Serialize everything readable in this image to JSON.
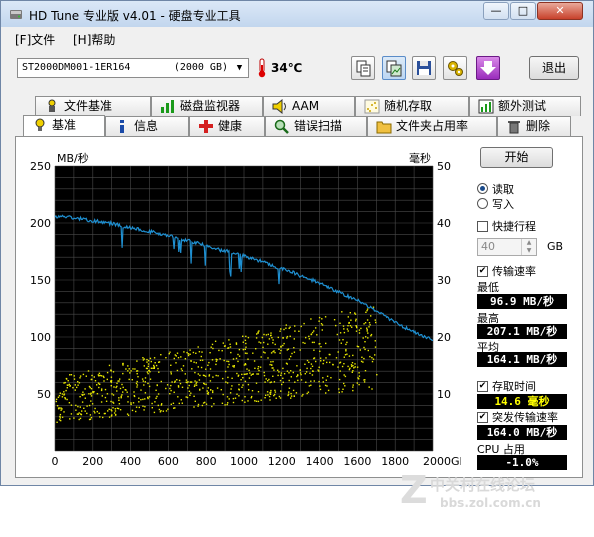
{
  "window": {
    "title": "HD Tune 专业版 v4.01 - 硬盘专业工具",
    "btn_min": "—",
    "btn_max": "□",
    "btn_close": "✕"
  },
  "menu": {
    "file": "[F]文件",
    "help": "[H]帮助"
  },
  "toolbar": {
    "drive_name": "ST2000DM001-1ER164",
    "drive_capacity": "(2000 GB)",
    "temperature": "34℃",
    "exit_label": "退出"
  },
  "tabs_top": [
    "文件基准",
    "磁盘监视器",
    "AAM",
    "随机存取",
    "额外测试"
  ],
  "tabs_bottom": [
    "基准",
    "信息",
    "健康",
    "错误扫描",
    "文件夹占用率",
    "删除"
  ],
  "right_panel": {
    "start_label": "开始",
    "read_label": "读取",
    "write_label": "写入",
    "short_stroke_label": "快捷行程",
    "short_stroke_value": "40",
    "short_stroke_unit": "GB",
    "transfer_rate_label": "传输速率",
    "min_label": "最低",
    "min_value": "96.9 MB/秒",
    "max_label": "最高",
    "max_value": "207.1 MB/秒",
    "avg_label": "平均",
    "avg_value": "164.1 MB/秒",
    "access_time_label": "存取时间",
    "access_time_value": "14.6 毫秒",
    "burst_label": "突发传输速率",
    "burst_value": "164.0 MB/秒",
    "cpu_label": "CPU 占用",
    "cpu_value": "-1.0%"
  },
  "watermark": {
    "line1": "中关村在线论坛",
    "line2": "bbs.zol.com.cn"
  },
  "colors": {
    "chart_bg": "#000000",
    "transfer_line": "#1f8fd0",
    "access_dots": "#e8e800",
    "grid": "#4a4a4a"
  },
  "chart_data": {
    "type": "line",
    "ylabel": "MB/秒",
    "y2label": "毫秒",
    "ylim": [
      0,
      250
    ],
    "y2lim": [
      0,
      50
    ],
    "xlim": [
      0,
      2000
    ],
    "x_ticks": [
      "0",
      "200",
      "400",
      "600",
      "800",
      "1000",
      "1200",
      "1400",
      "1600",
      "1800",
      "2000GB"
    ],
    "y_ticks": [
      "250",
      "200",
      "150",
      "100",
      "50"
    ],
    "y2_ticks": [
      "50",
      "40",
      "30",
      "20",
      "10"
    ],
    "series": [
      {
        "kind": "transfer_rate",
        "axis": "left",
        "x": [
          0,
          40,
          80,
          120,
          160,
          200,
          240,
          280,
          320,
          360,
          400,
          440,
          480,
          520,
          560,
          600,
          640,
          680,
          720,
          760,
          800,
          840,
          880,
          920,
          960,
          1000,
          1040,
          1080,
          1120,
          1160,
          1200,
          1240,
          1280,
          1320,
          1360,
          1400,
          1440,
          1480,
          1520,
          1560,
          1600,
          1640,
          1680,
          1720,
          1760,
          1800,
          1840,
          1880,
          1920,
          1960,
          2000
        ],
        "y": [
          205,
          206,
          205,
          204,
          203,
          202,
          201,
          200,
          199,
          197,
          196,
          195,
          193,
          192,
          190,
          189,
          187,
          185,
          184,
          182,
          180,
          178,
          176,
          175,
          173,
          171,
          169,
          167,
          165,
          162,
          160,
          158,
          155,
          152,
          150,
          147,
          144,
          141,
          138,
          135,
          132,
          128,
          125,
          121,
          117,
          113,
          109,
          106,
          103,
          100,
          97
        ]
      },
      {
        "kind": "access_time",
        "axis": "right",
        "render": "scatter",
        "x_range": [
          0,
          1700
        ],
        "y_start_range": [
          5,
          13
        ],
        "y_end_range": [
          11,
          26
        ]
      }
    ]
  }
}
